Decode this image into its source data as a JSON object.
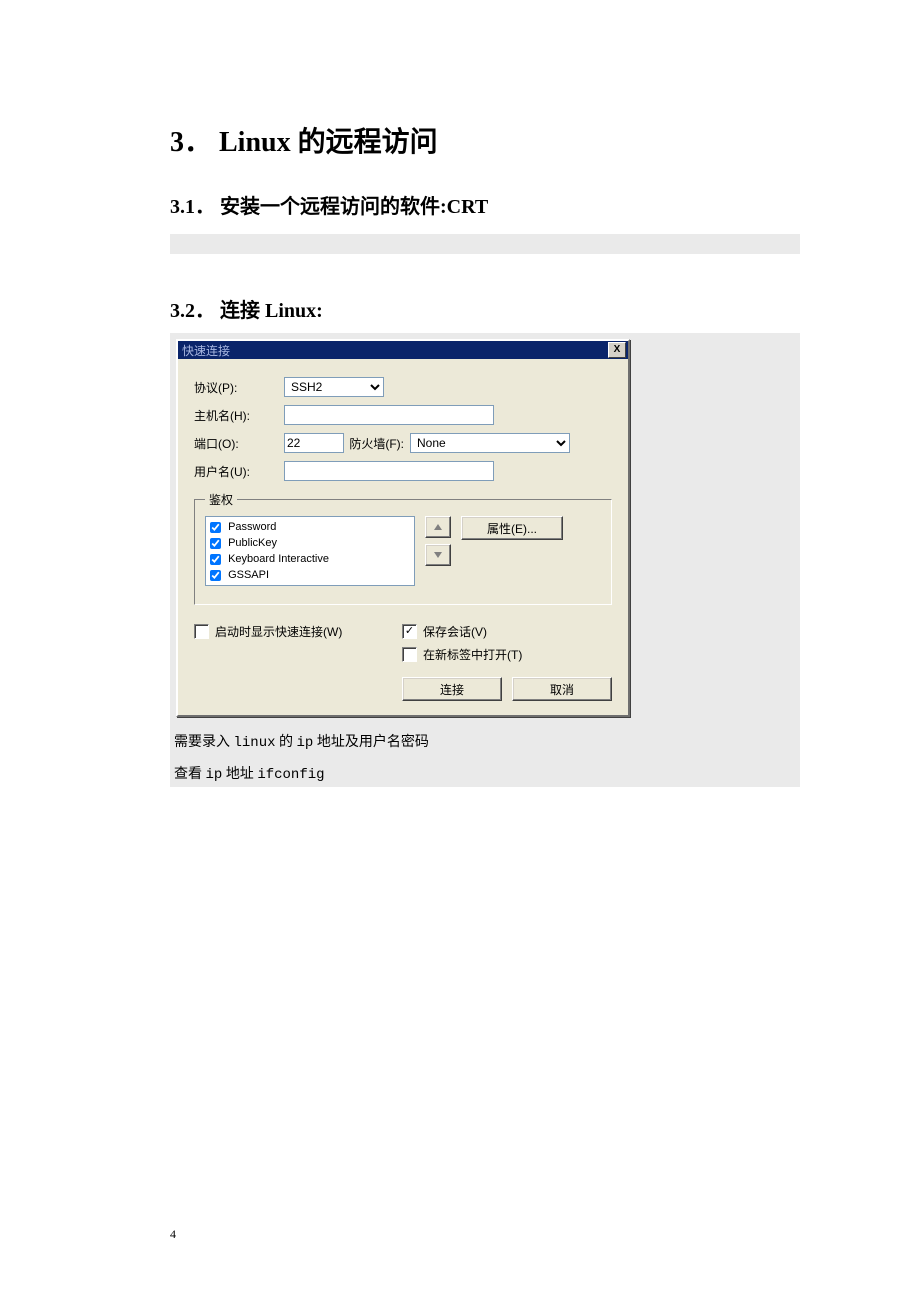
{
  "headings": {
    "h1": "3．  Linux 的远程访问",
    "h2a": "3.1．  安装一个远程访问的软件:CRT",
    "h2b": "3.2．  连接 Linux:"
  },
  "dialog": {
    "title": "快速连接",
    "labels": {
      "protocol": "协议(P):",
      "hostname": "主机名(H):",
      "port": "端口(O):",
      "firewall": "防火墙(F):",
      "username": "用户名(U):",
      "auth_legend": "鉴权",
      "properties": "属性(E)...",
      "show_on_start": "启动时显示快速连接(W)",
      "save_session": "保存会话(V)",
      "open_in_tab": "在新标签中打开(T)",
      "connect": "连接",
      "cancel": "取消"
    },
    "values": {
      "protocol": "SSH2",
      "hostname": "",
      "port": "22",
      "firewall": "None",
      "username": ""
    },
    "auth_methods": {
      "password": "Password",
      "publickey": "PublicKey",
      "keyboard": "Keyboard Interactive",
      "gssapi": "GSSAPI"
    }
  },
  "notes": {
    "line1_a": "需要录入 ",
    "line1_b": "linux",
    "line1_c": " 的 ",
    "line1_d": "ip",
    "line1_e": " 地址及用户名密码",
    "line2_a": "查看 ",
    "line2_b": "ip",
    "line2_c": " 地址 ",
    "line2_d": "ifconfig"
  },
  "page_number": "4"
}
